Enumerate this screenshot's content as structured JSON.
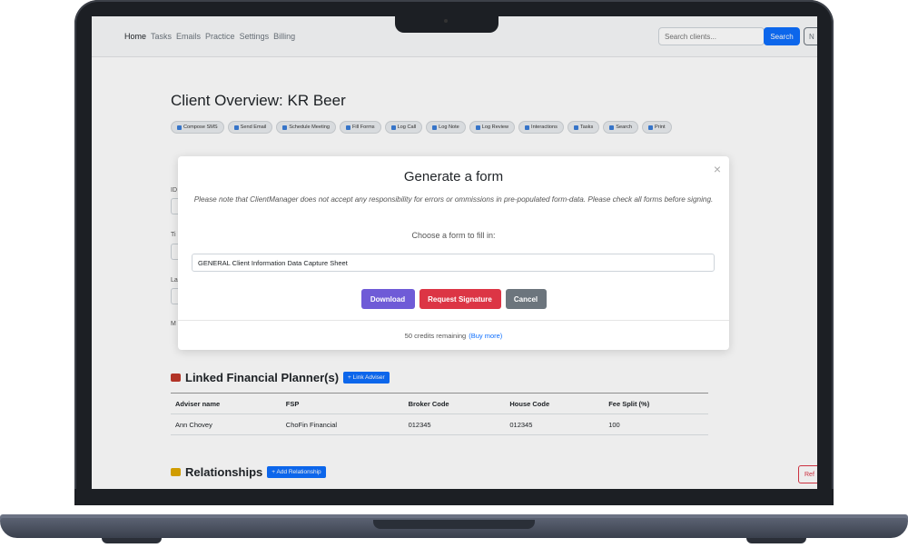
{
  "nav": {
    "links": [
      "Home",
      "Tasks",
      "Emails",
      "Practice",
      "Settings",
      "Billing"
    ],
    "search_placeholder": "Search clients...",
    "search_button": "Search",
    "extra_button": "N"
  },
  "page": {
    "title": "Client Overview: KR Beer"
  },
  "actions": [
    "Compose SMS",
    "Send Email",
    "Schedule Meeting",
    "Fill Forms",
    "Log Call",
    "Log Note",
    "Log Review",
    "Interactions",
    "Tasks",
    "Search",
    "Print"
  ],
  "background_labels": [
    "ID",
    "Ti",
    "La",
    "M"
  ],
  "planners": {
    "title": "Linked Financial Planner(s)",
    "link_button": "+ Link Adviser",
    "columns": [
      "Adviser name",
      "FSP",
      "Broker Code",
      "House Code",
      "Fee Split (%)"
    ],
    "rows": [
      [
        "Ann Chovey",
        "ChoFin Financial",
        "012345",
        "012345",
        "100"
      ]
    ]
  },
  "relationships": {
    "title": "Relationships",
    "add_button": "+ Add Relationship"
  },
  "ref_button": "Ref",
  "modal": {
    "title": "Generate a form",
    "close": "×",
    "note": "Please note that ClientManager does not accept any responsibility for errors or ommissions in pre-populated form-data. Please check all forms before signing.",
    "choose_label": "Choose a form to fill in:",
    "selected_form": "GENERAL Client Information Data Capture Sheet",
    "download": "Download",
    "request_signature": "Request Signature",
    "cancel": "Cancel",
    "credits": "50 credits remaining",
    "buy_more": "(Buy more)"
  },
  "colors": {
    "primary": "#0d6efd",
    "danger": "#dc3545",
    "download": "#6f5bd7",
    "secondary": "#6c757d"
  }
}
